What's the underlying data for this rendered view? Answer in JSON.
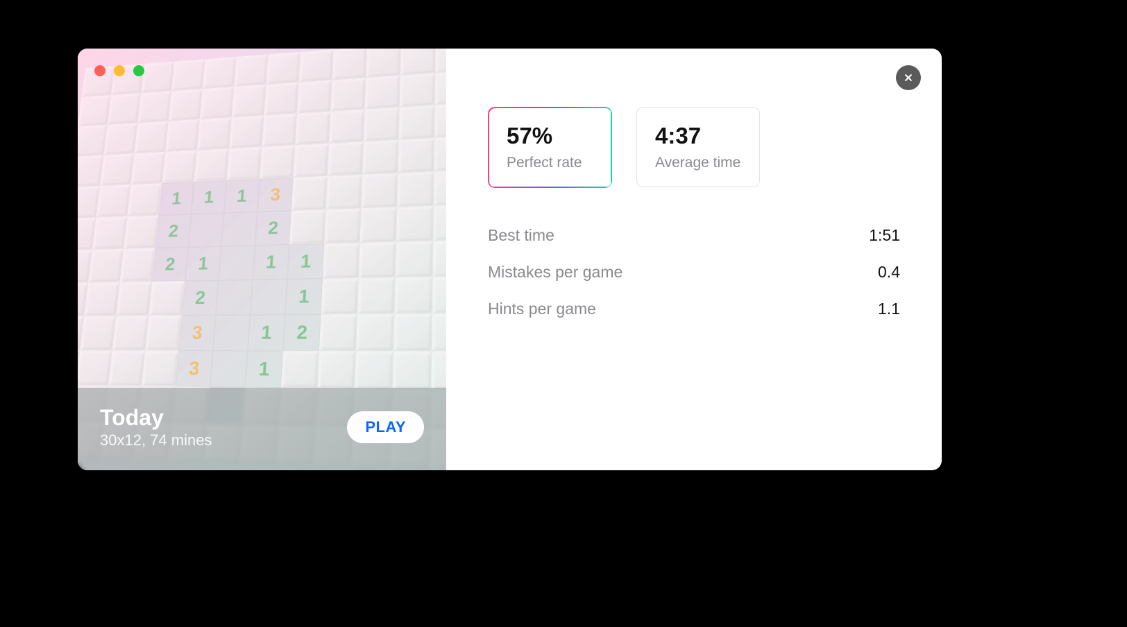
{
  "game": {
    "title": "Today",
    "subtitle": "30x12, 74 mines",
    "play_label": "PLAY"
  },
  "cards": [
    {
      "value": "57%",
      "label": "Perfect rate",
      "active": true
    },
    {
      "value": "4:37",
      "label": "Average time",
      "active": false
    }
  ],
  "stats": [
    {
      "label": "Best time",
      "value": "1:51"
    },
    {
      "label": "Mistakes per game",
      "value": "0.4"
    },
    {
      "label": "Hints per game",
      "value": "1.1"
    }
  ],
  "board_rows": [
    [
      "",
      "",
      "",
      "",
      "",
      "",
      "",
      "",
      "",
      "",
      "",
      "",
      "",
      ""
    ],
    [
      "",
      "",
      "",
      "",
      "",
      "",
      "",
      "",
      "",
      "",
      "",
      "",
      "",
      ""
    ],
    [
      "",
      "",
      "",
      "",
      "",
      "",
      "",
      "",
      "",
      "",
      "",
      "",
      "",
      ""
    ],
    [
      "",
      "",
      "",
      "",
      "",
      "",
      "",
      "",
      "",
      "",
      "",
      "",
      "",
      ""
    ],
    [
      "",
      "",
      "",
      "1",
      "1",
      "1",
      "3",
      "",
      "",
      "",
      "",
      "",
      "",
      ""
    ],
    [
      "",
      "",
      "",
      "2",
      "r",
      "r",
      "2",
      "",
      "",
      "",
      "",
      "",
      "",
      ""
    ],
    [
      "",
      "",
      "",
      "2",
      "1",
      "r",
      "1",
      "1",
      "",
      "",
      "",
      "",
      "",
      ""
    ],
    [
      "",
      "",
      "",
      "",
      "2",
      "r",
      "r",
      "1",
      "",
      "",
      "",
      "",
      "",
      ""
    ],
    [
      "",
      "",
      "",
      "",
      "3",
      "r",
      "1",
      "2",
      "",
      "",
      "",
      "",
      "",
      ""
    ],
    [
      "",
      "",
      "",
      "",
      "3",
      "r",
      "1",
      "",
      "",
      "",
      "",
      "",
      "",
      ""
    ],
    [
      "",
      "",
      "",
      "",
      "",
      "r",
      "",
      "",
      "",
      "",
      "",
      "",
      "",
      ""
    ],
    [
      "",
      "",
      "",
      "",
      "",
      "",
      "",
      "",
      "",
      "",
      "",
      "",
      "",
      ""
    ]
  ]
}
